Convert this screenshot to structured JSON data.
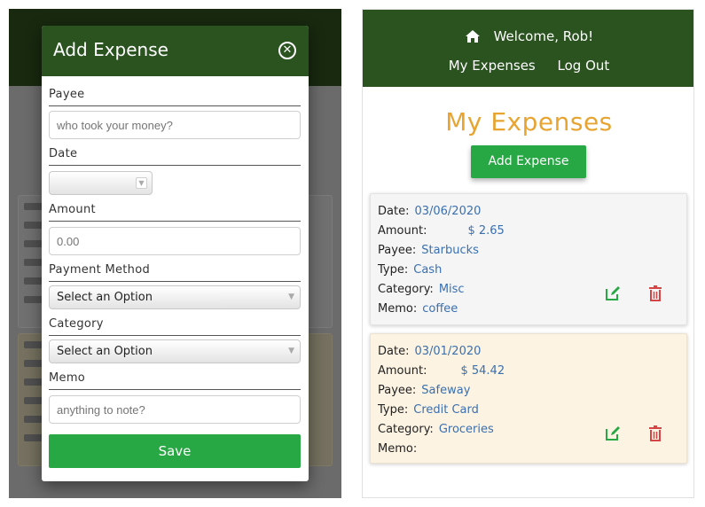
{
  "modal": {
    "title": "Add Expense",
    "fields": {
      "payee_label": "Payee",
      "payee_placeholder": "who took your money?",
      "date_label": "Date",
      "amount_label": "Amount",
      "amount_placeholder": "0.00",
      "payment_label": "Payment Method",
      "payment_value": "Select an Option",
      "category_label": "Category",
      "category_value": "Select an Option",
      "memo_label": "Memo",
      "memo_placeholder": "anything to note?"
    },
    "save_label": "Save"
  },
  "nav": {
    "welcome": "Welcome, Rob!",
    "links": [
      "My Expenses",
      "Log Out"
    ]
  },
  "page": {
    "title": "My Expenses",
    "add_button": "Add Expense"
  },
  "labels": {
    "date": "Date:",
    "amount": "Amount:",
    "payee": "Payee:",
    "type": "Type:",
    "category": "Category:",
    "memo": "Memo:"
  },
  "expenses": [
    {
      "date": "03/06/2020",
      "amount": "$ 2.65",
      "payee": "Starbucks",
      "type": "Cash",
      "category": "Misc",
      "memo": "coffee"
    },
    {
      "date": "03/01/2020",
      "amount": "$ 54.42",
      "payee": "Safeway",
      "type": "Credit Card",
      "category": "Groceries",
      "memo": ""
    }
  ],
  "colors": {
    "header_green": "#2a5320",
    "button_green": "#28a745",
    "title_orange": "#e8a431",
    "value_blue": "#3a6fb0",
    "delete_red": "#d64545"
  },
  "icons": [
    "close-icon",
    "home-icon",
    "edit-icon",
    "trash-icon",
    "chevron-down-icon"
  ]
}
